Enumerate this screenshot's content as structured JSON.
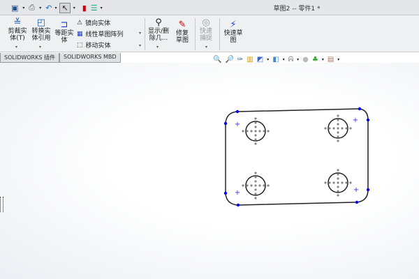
{
  "window": {
    "title": "草图2 -- 零件1 *"
  },
  "quick_access": {
    "icons": [
      "save-icon",
      "print-icon",
      "undo-icon",
      "select-icon",
      "rebuild-icon",
      "options-icon"
    ]
  },
  "ribbon": {
    "trim": "剪裁实体(T)",
    "convert": "转换实体引用",
    "offset": "等距实体",
    "mirror": "镜向实体",
    "linear_pattern": "线性草图阵列",
    "move": "移动实体",
    "display_delete": "显示/删除几...",
    "repair": "修复草图",
    "quick_snap": "快速捕捉",
    "rapid_sketch": "快速草图"
  },
  "tabs": [
    "SOLIDWORKS 插件",
    "SOLIDWORKS MBD"
  ],
  "colors": {
    "point": "#0000ff",
    "line": "#222222",
    "construction": "#888888"
  }
}
